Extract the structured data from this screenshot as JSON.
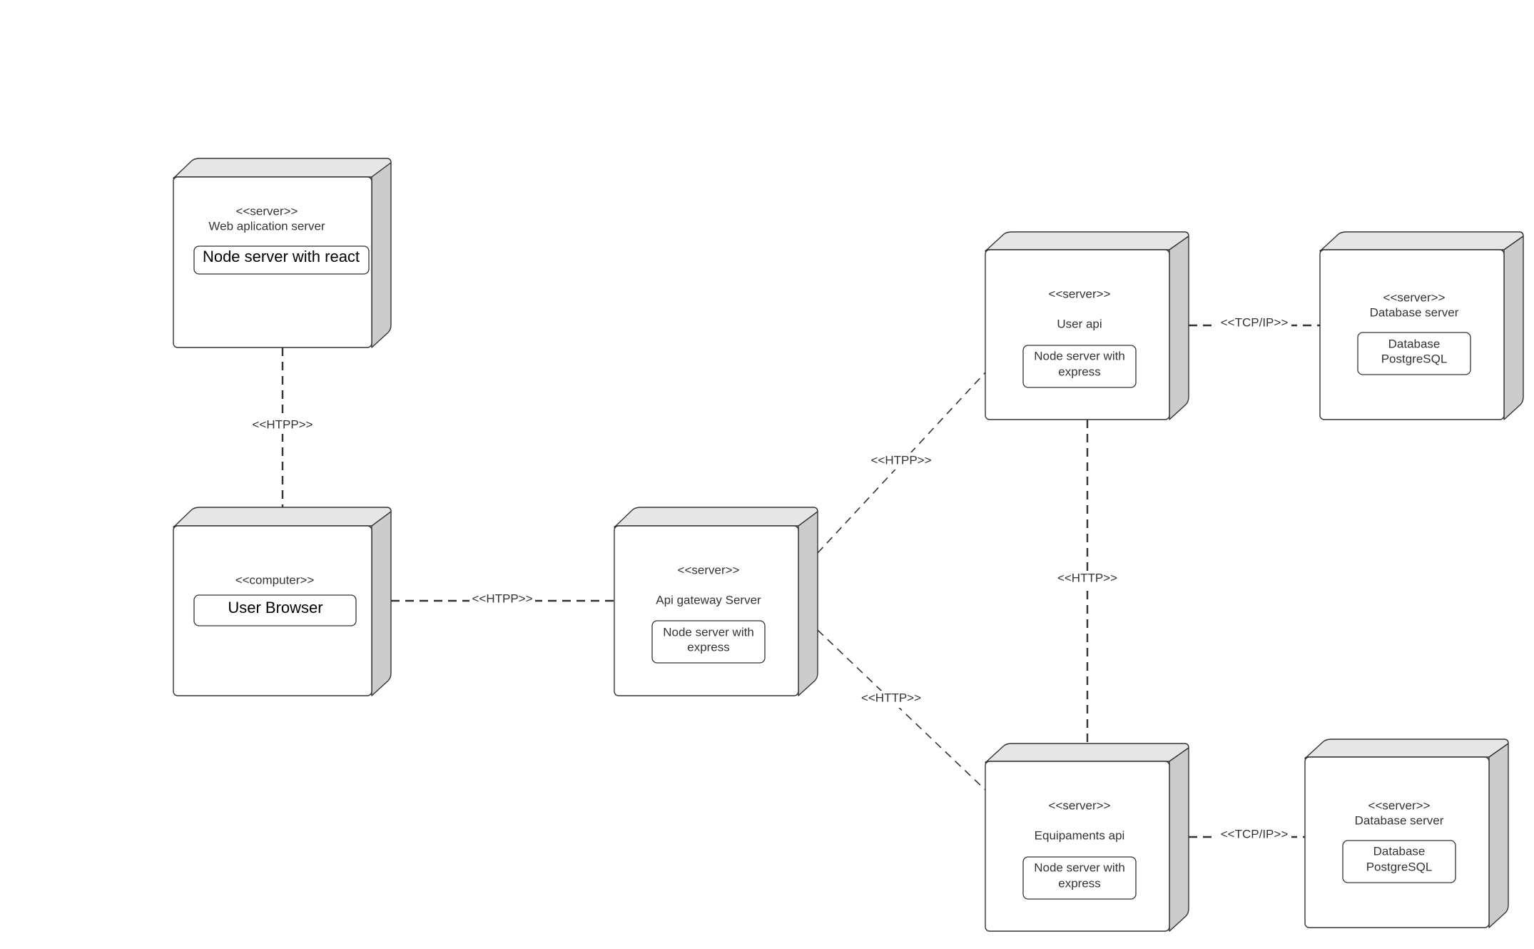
{
  "diagram": {
    "type": "UML deployment diagram",
    "colors": {
      "outline": "#333333",
      "node_top_face": "#e6e6e6",
      "node_side_face": "#cccccc",
      "node_front_face": "#ffffff",
      "text": "#333333"
    },
    "nodes": {
      "web_app": {
        "stereotype": "<<server>>",
        "name": "Web aplication server",
        "artifact": [
          "Node server with react"
        ]
      },
      "user_browser": {
        "stereotype": "<<computer>>",
        "name": "",
        "artifact": [
          "User Browser"
        ]
      },
      "api_gateway": {
        "stereotype": "<<server>>",
        "name": "Api gateway Server",
        "artifact": [
          "Node server with",
          "express"
        ]
      },
      "user_api": {
        "stereotype": "<<server>>",
        "name": "User api",
        "artifact": [
          "Node server with",
          "express"
        ]
      },
      "db_server_1": {
        "stereotype": "<<server>>",
        "name": "Database server",
        "artifact": [
          "Database",
          "PostgreSQL"
        ]
      },
      "equipaments_api": {
        "stereotype": "<<server>>",
        "name": "Equipaments api",
        "artifact": [
          "Node server with",
          "express"
        ]
      },
      "db_server_2": {
        "stereotype": "<<server>>",
        "name": "Database server",
        "artifact": [
          "Database",
          "PostgreSQL"
        ]
      }
    },
    "connections": {
      "webapp_browser": {
        "from": "Web aplication server",
        "to": "User Browser",
        "label": "<<HTPP>>"
      },
      "browser_gateway": {
        "from": "User Browser",
        "to": "Api gateway Server",
        "label": "<<HTPP>>"
      },
      "gateway_userapi": {
        "from": "Api gateway Server",
        "to": "User api",
        "label": "<<HTPP>>"
      },
      "gateway_equip": {
        "from": "Api gateway Server",
        "to": "Equipaments api",
        "label": "<<HTTP>>"
      },
      "userapi_equip": {
        "from": "User api",
        "to": "Equipaments api",
        "label": "<<HTTP>>"
      },
      "userapi_db1": {
        "from": "User api",
        "to": "Database server",
        "label": "<<TCP/IP>>"
      },
      "equip_db2": {
        "from": "Equipaments api",
        "to": "Database server",
        "label": "<<TCP/IP>>"
      }
    }
  }
}
